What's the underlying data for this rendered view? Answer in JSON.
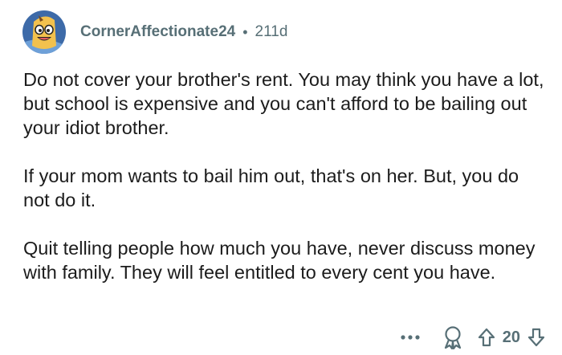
{
  "comment": {
    "author": "CornerAffectionate24",
    "separator": "•",
    "age": "211d",
    "paragraphs": [
      "Do not cover your brother's rent. You may think you have a lot, but school is expensive and you can't afford to be bailing out your idiot brother.",
      "If your mom wants to bail him out, that's on her.  But, you do not do it.",
      "Quit telling people how much you have,  never discuss money with family. They will feel entitled to every cent you have."
    ]
  },
  "actions": {
    "more_icon": "more-options-icon",
    "award_icon": "award-icon",
    "upvote_icon": "upvote-arrow-icon",
    "score": "20",
    "downvote_icon": "downvote-arrow-icon"
  },
  "colors": {
    "avatar_bg": "#3d6aa8",
    "avatar_figure": "#f2c14e",
    "meta_text": "#576f76",
    "body_text": "#1c1c1c"
  }
}
